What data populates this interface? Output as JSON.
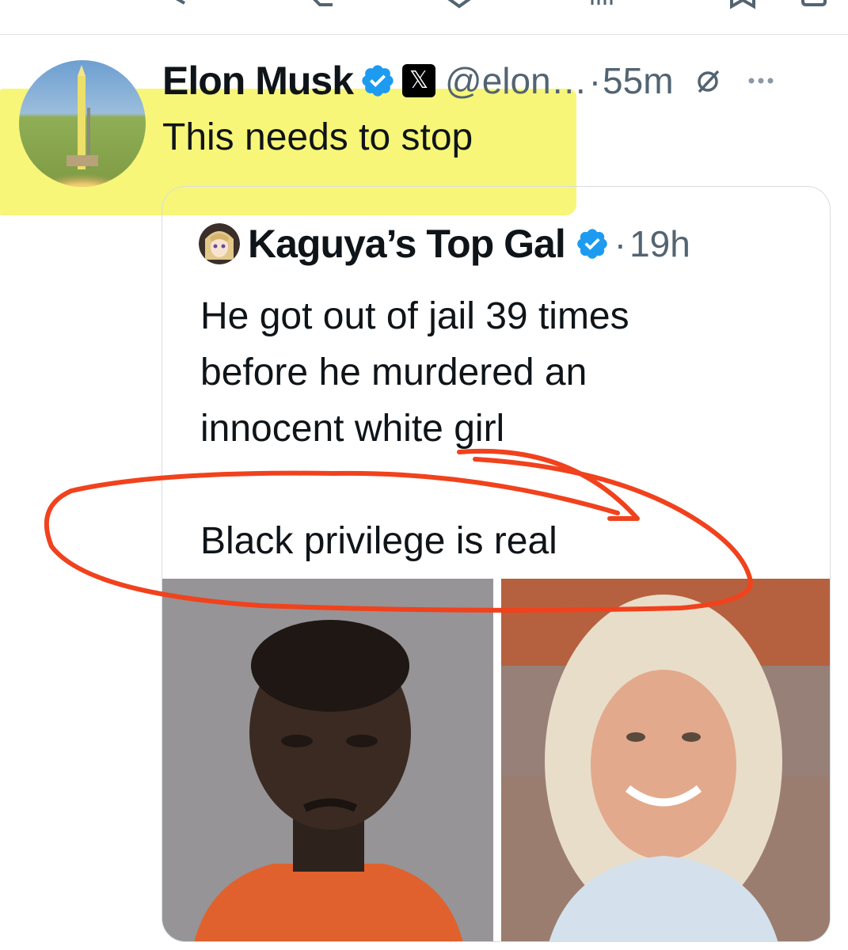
{
  "action_bar": {
    "icons": [
      "reply-icon",
      "retweet-icon",
      "like-icon",
      "views-icon",
      "bookmark-icon",
      "share-icon"
    ]
  },
  "tweet": {
    "display_name": "Elon Musk",
    "handle": "@elon…",
    "separator": "·",
    "time": "55m",
    "x_badge": "𝕏",
    "text": "This needs to stop"
  },
  "quote": {
    "display_name": "Kaguya’s Top Gal",
    "separator": "·",
    "time": "19h",
    "lines": [
      "He got out of jail 39 times",
      "before he murdered an",
      "innocent white girl"
    ],
    "last_line": "Black privilege is real"
  },
  "colors": {
    "verified_blue": "#1d9bf0",
    "highlight": "#f6f56e",
    "annotation_red": "#f0421d",
    "secondary_text": "#536471"
  }
}
